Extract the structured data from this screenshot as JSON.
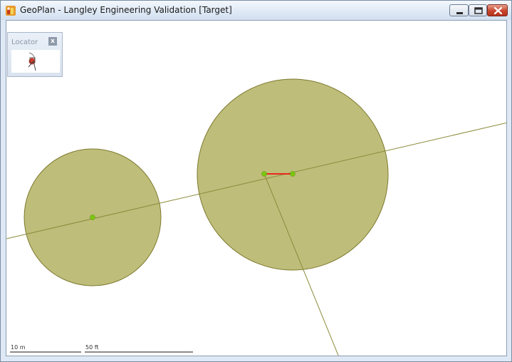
{
  "window": {
    "title": "GeoPlan - Langley Engineering Validation [Target]",
    "app_icon": "geoplan-app-icon",
    "controls": {
      "minimize_icon": "minimize-icon",
      "maximize_icon": "maximize-icon",
      "close_icon": "close-icon"
    }
  },
  "locator": {
    "title": "Locator",
    "close_glyph": "x"
  },
  "scale": {
    "metric_label": "10 m",
    "imperial_label": "50 ft"
  },
  "colors": {
    "circle_fill": "#bfbd7a",
    "circle_stroke": "#7d7a2e",
    "line": "#8b8a3a",
    "point": "#7ac70f",
    "segment": "#e8281c"
  }
}
